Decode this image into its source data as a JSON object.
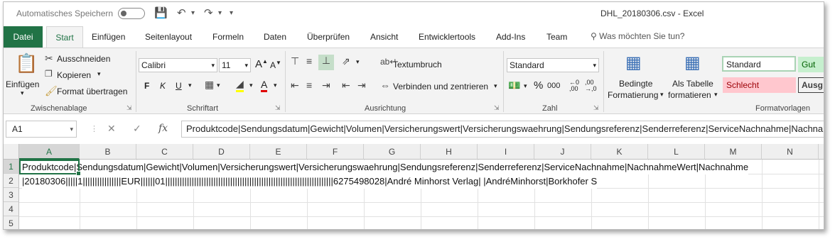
{
  "titlebar": {
    "autosave_label": "Automatisches Speichern",
    "title": "DHL_20180306.csv  -  Excel"
  },
  "tabs": [
    "Datei",
    "Start",
    "Einfügen",
    "Seitenlayout",
    "Formeln",
    "Daten",
    "Überprüfen",
    "Ansicht",
    "Entwicklertools",
    "Add-Ins",
    "Team"
  ],
  "search_placeholder": "Was möchten Sie tun?",
  "ribbon": {
    "clipboard": {
      "paste": "Einfügen",
      "cut": "Ausschneiden",
      "copy": "Kopieren",
      "format_painter": "Format übertragen",
      "group": "Zwischenablage"
    },
    "font": {
      "font_name": "Calibri",
      "font_size": "11",
      "bold": "F",
      "italic": "K",
      "underline": "U",
      "group": "Schriftart"
    },
    "alignment": {
      "wrap_text": "Textumbruch",
      "merge_center": "Verbinden und zentrieren",
      "group": "Ausrichtung"
    },
    "number": {
      "format": "Standard",
      "percent": "%",
      "thousands": "000",
      "group": "Zahl"
    },
    "styles": {
      "conditional_line1": "Bedingte",
      "conditional_line2": "Formatierung",
      "table_line1": "Als Tabelle",
      "table_line2": "formatieren",
      "style_standard": "Standard",
      "style_gut": "Gut",
      "style_schlecht": "Schlecht",
      "style_ausgabe": "Ausg",
      "group": "Formatvorlagen"
    }
  },
  "formula_bar": {
    "name_box": "A1",
    "fx": "fx",
    "content": "Produktcode|Sendungsdatum|Gewicht|Volumen|Versicherungswert|Versicherungswaehrung|Sendungsreferenz|Senderreferenz|ServiceNachnahme|NachnahmeWert|Nachnahm"
  },
  "columns": [
    "A",
    "B",
    "C",
    "D",
    "E",
    "F",
    "G",
    "H",
    "I",
    "J",
    "K",
    "L",
    "M",
    "N"
  ],
  "rows": [
    "1",
    "2",
    "3",
    "4",
    "5"
  ],
  "cells": {
    "row1": "Produktcode|Sendungsdatum|Gewicht|Volumen|Versicherungswert|Versicherungswaehrung|Sendungsreferenz|Senderreferenz|ServiceNachnahme|NachnahmeWert|Nachnahme",
    "row2": "|20180306|||||1||||||||||||||||EUR||||||01||||||||||||||||||||||||||||||||||||||||||||||||||||||||||||||||||||||6275498028|André Minhorst Verlag|   |AndréMinhorst|Borkhofer S"
  },
  "colors": {
    "accent": "#217346",
    "style_gut_bg": "#c6efce",
    "style_schlecht_bg": "#ffc7ce"
  }
}
